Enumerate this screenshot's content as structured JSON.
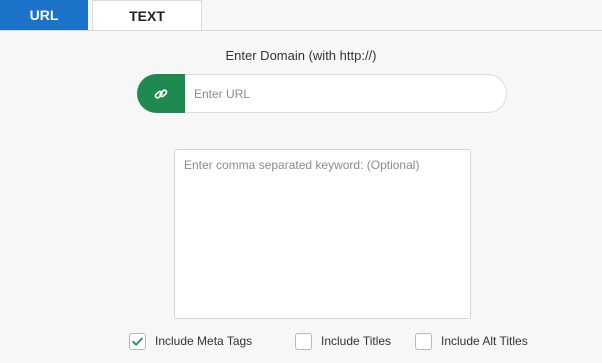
{
  "tabs": {
    "url_label": "URL",
    "text_label": "TEXT",
    "active": "URL"
  },
  "form": {
    "domain_label": "Enter Domain (with http://)",
    "url_placeholder": "Enter URL",
    "url_value": "",
    "keyword_placeholder": "Enter comma separated keyword: (Optional)",
    "keyword_value": ""
  },
  "options": {
    "meta_tags": {
      "label": "Include Meta Tags",
      "checked": true
    },
    "titles": {
      "label": "Include Titles",
      "checked": false
    },
    "alt_titles": {
      "label": "Include Alt Titles",
      "checked": false
    }
  },
  "colors": {
    "tab_active": "#1a73c8",
    "link_button": "#1e8a4f",
    "checkmark": "#1e8a4f"
  },
  "icons": {
    "url_button": "link-icon",
    "checked": "checkmark-icon"
  }
}
